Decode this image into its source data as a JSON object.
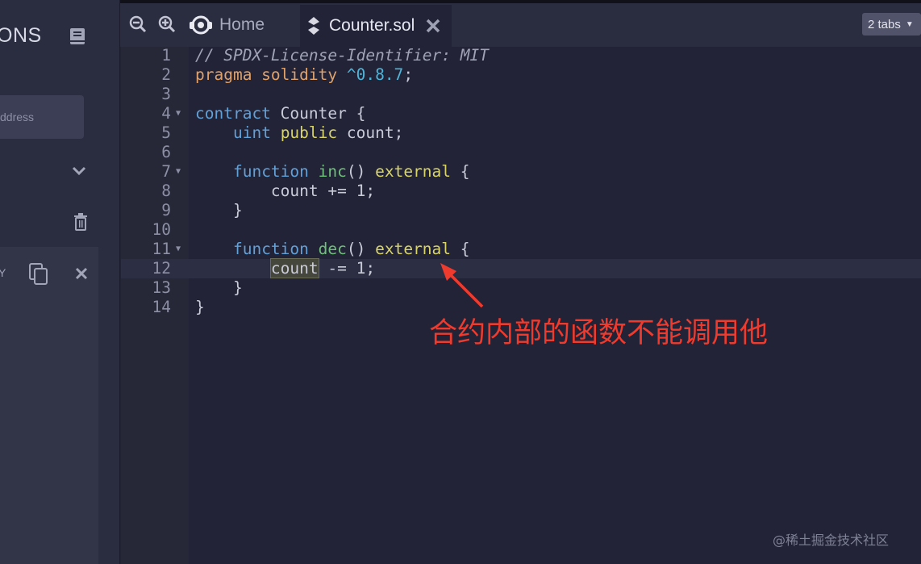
{
  "sidebar": {
    "title": "ONS",
    "address_placeholder": "ddress",
    "row_label": "Y"
  },
  "tabs": {
    "home_label": "Home",
    "active_label": "Counter.sol",
    "dropdown_label": "2 tabs"
  },
  "editor": {
    "lines": [
      {
        "num": "1"
      },
      {
        "num": "2"
      },
      {
        "num": "3"
      },
      {
        "num": "4"
      },
      {
        "num": "5"
      },
      {
        "num": "6"
      },
      {
        "num": "7"
      },
      {
        "num": "8"
      },
      {
        "num": "9"
      },
      {
        "num": "10"
      },
      {
        "num": "11"
      },
      {
        "num": "12"
      },
      {
        "num": "13"
      },
      {
        "num": "14"
      }
    ],
    "code": {
      "l1": "// SPDX-License-Identifier: MIT",
      "l2_pragma": "pragma solidity",
      "l2_ver": "^0.8.7",
      "l2_end": ";",
      "l4_kw": "contract",
      "l4_rest": " Counter {",
      "l5_kw": "uint",
      "l5_mod": "public",
      "l5_rest": " count;",
      "l7_kw": "function",
      "l7_fn": "inc",
      "l7_mid": "() ",
      "l7_mod": "external",
      "l7_end": " {",
      "l8": "count += 1;",
      "l9": "}",
      "l11_kw": "function",
      "l11_fn": "dec",
      "l11_mid": "() ",
      "l11_mod": "external",
      "l11_end": " {",
      "l12_hl": "count",
      "l12_rest": " -= 1;",
      "l13": "}",
      "l14": "}"
    },
    "folded_lines": [
      "4",
      "7",
      "11"
    ],
    "active_line": "12"
  },
  "annotation": {
    "text": "合约内部的函数不能调用他",
    "color": "#ee3b2e"
  },
  "watermark": "@稀土掘金技术社区",
  "colors": {
    "background": "#222336",
    "panel": "#2a2c3f",
    "keyword": "#62a0d8",
    "function_name": "#6fc07a",
    "modifier": "#d8d46a",
    "pragma": "#e0a26a",
    "version": "#4fb4d8"
  },
  "icons": [
    "zoom-out-icon",
    "zoom-in-icon",
    "home-icon",
    "solidity-icon",
    "close-icon",
    "book-icon",
    "chevron-down-icon",
    "trash-icon",
    "copy-icon"
  ]
}
